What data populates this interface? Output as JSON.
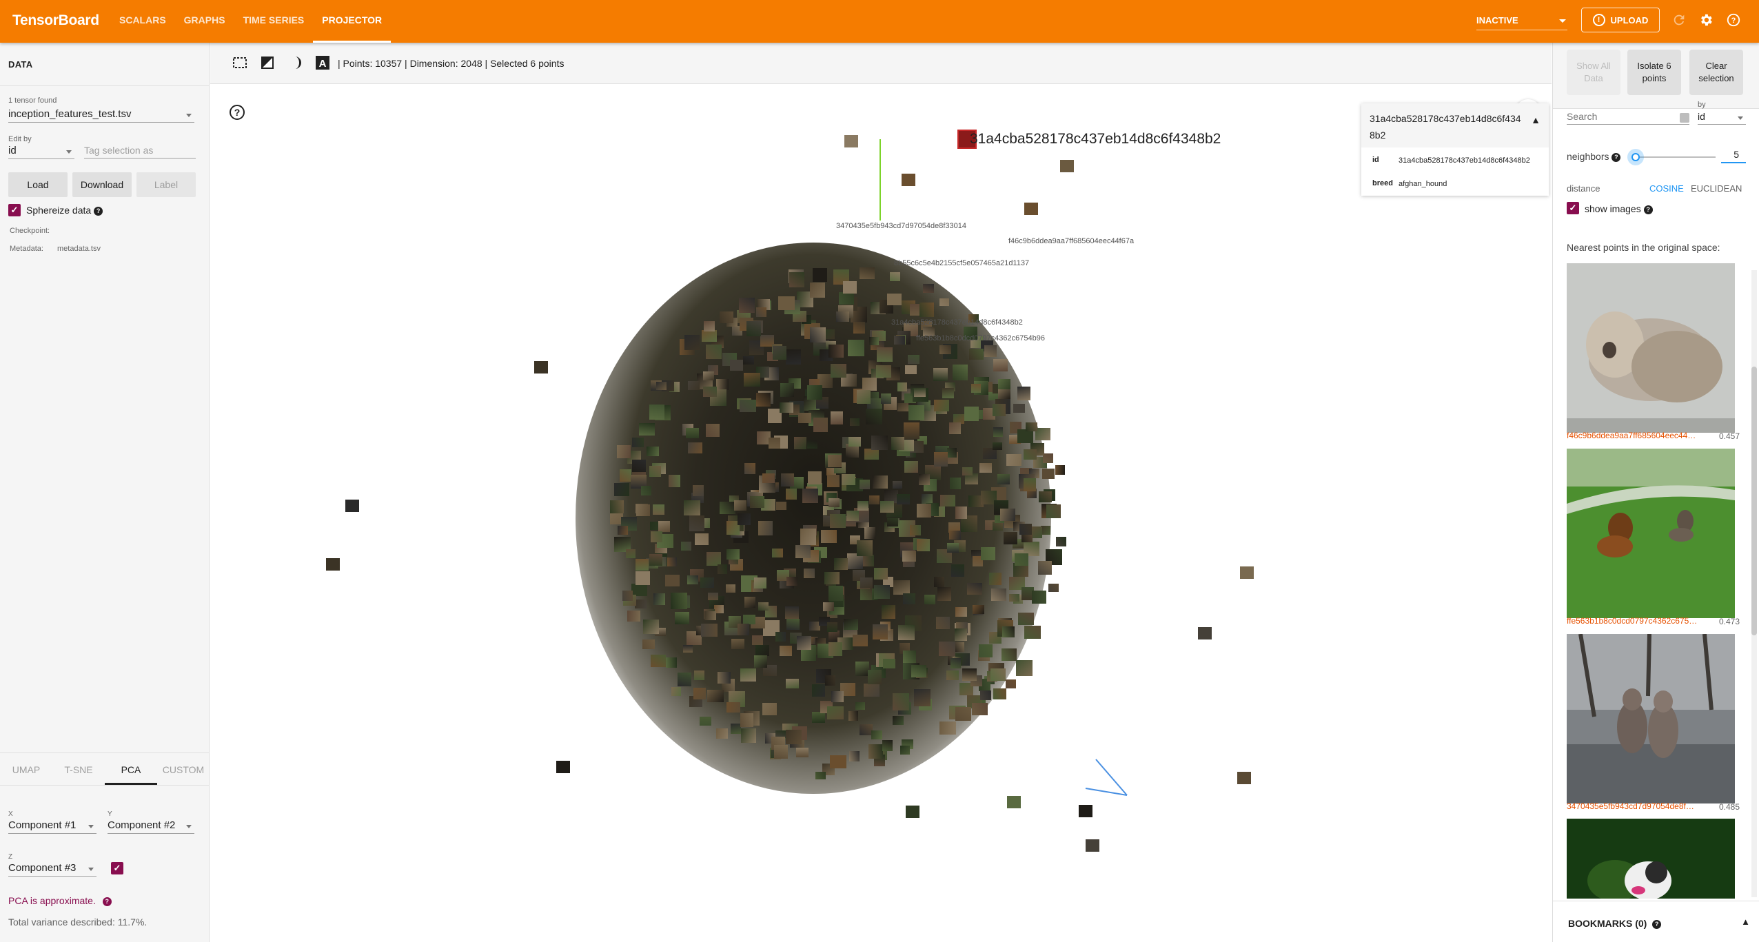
{
  "app": {
    "brand": "TensorBoard",
    "nav": [
      "SCALARS",
      "GRAPHS",
      "TIME SERIES",
      "PROJECTOR"
    ],
    "active_nav": "PROJECTOR",
    "run_status": "INACTIVE",
    "upload_label": "UPLOAD",
    "icons": [
      "refresh-icon",
      "settings-icon",
      "help-icon"
    ]
  },
  "left": {
    "title": "DATA",
    "tensor_found_label": "1 tensor found",
    "tensor_value": "inception_features_test.tsv",
    "edit_by_label": "Edit by",
    "edit_by_value": "id",
    "tag_placeholder": "Tag selection as",
    "buttons": {
      "load": "Load",
      "download": "Download",
      "label": "Label"
    },
    "sphereize_label": "Sphereize data",
    "sphereize_checked": true,
    "checkpoint_label": "Checkpoint:",
    "metadata_label": "Metadata:",
    "metadata_value": "metadata.tsv",
    "tabs": [
      "UMAP",
      "T-SNE",
      "PCA",
      "CUSTOM"
    ],
    "active_tab": "PCA",
    "pca": {
      "x_label": "X",
      "x_value": "Component #1",
      "y_label": "Y",
      "y_value": "Component #2",
      "z_label": "Z",
      "z_value": "Component #3",
      "z_checked": true,
      "approx_note": "PCA is approximate.",
      "variance": "Total variance described: 11.7%."
    }
  },
  "toolbar": {
    "points": "Points: 10357",
    "dimension": "Dimension: 2048",
    "selected": "Selected 6 points",
    "separator": "|"
  },
  "scatter": {
    "selected_label": "31a4cba528178c437eb14d8c6f4348b2",
    "neighbor_labels": [
      "3470435e5fb943cd7d97054de8f33014",
      "f46c9b6ddea9aa7ff685604eec44f67a",
      "8b55c6c5e4b2155cf5e057465a21d1137",
      "31a4cba528178c437eb14d8c6f4348b2",
      "ffe563b1b8c0dcd0797c4362c6754b96"
    ]
  },
  "card": {
    "title": "31a4cba528178c437eb14d8c6f4348b2",
    "rows": [
      {
        "key": "id",
        "value": "31a4cba528178c437eb14d8c6f4348b2"
      },
      {
        "key": "breed",
        "value": "afghan_hound"
      }
    ]
  },
  "right": {
    "buttons": {
      "show_all": "Show All Data",
      "isolate": "Isolate 6 points",
      "clear": "Clear selection"
    },
    "search_placeholder": "Search",
    "by_label": "by",
    "by_value": "id",
    "neighbors_label": "neighbors",
    "neighbors_value": "5",
    "distance_label": "distance",
    "distance_options": [
      "COSINE",
      "EUCLIDEAN"
    ],
    "distance_selected": "COSINE",
    "show_images_label": "show images",
    "show_images_checked": true,
    "nearest_title": "Nearest points in the original space:",
    "neighbors": [
      {
        "id": "f46c9b6ddea9aa7ff685604eec44f67a",
        "dist": "0.457",
        "scene": "fluffy"
      },
      {
        "id": "ffe563b1b8c0dcd0797c4362c6754b...",
        "dist": "0.473",
        "scene": "lawn"
      },
      {
        "id": "3470435e5fb943cd7d97054de8f330...",
        "dist": "0.485",
        "scene": "rain"
      },
      {
        "id": "",
        "dist": "",
        "scene": "dark"
      }
    ],
    "bookmarks": "BOOKMARKS (0)"
  },
  "colors": {
    "topbar": "#f57c00",
    "accent_checkbox": "#880e4f",
    "accent_link": "#e65100",
    "cosine_active": "#2196f3"
  }
}
